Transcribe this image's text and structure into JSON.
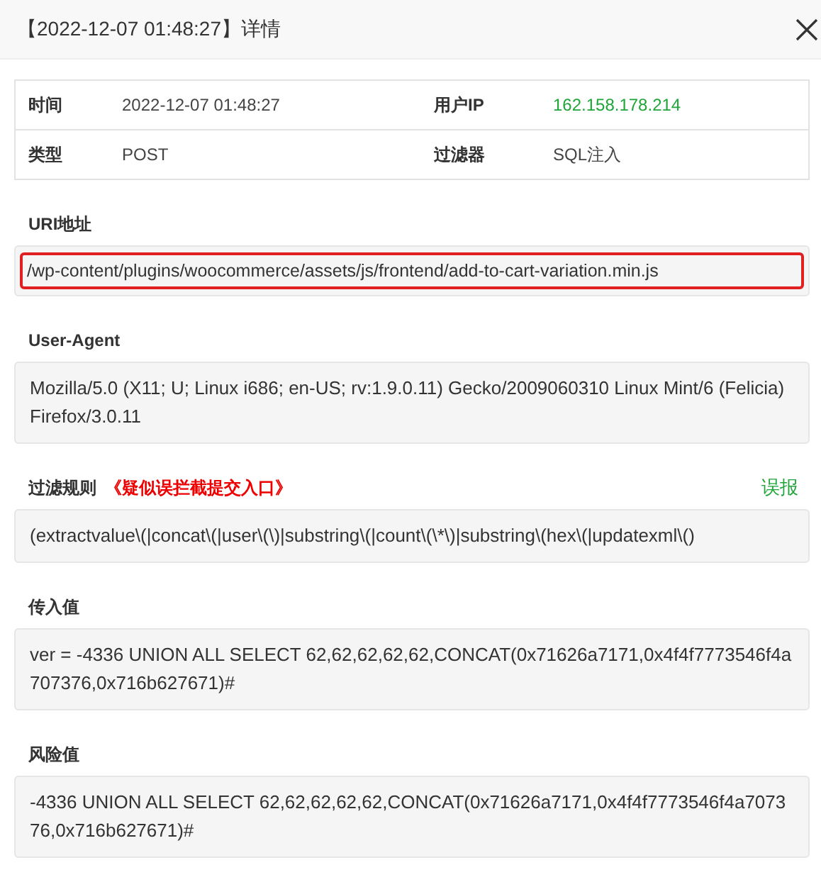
{
  "dialog": {
    "title": "【2022-12-07 01:48:27】详情"
  },
  "info_rows": [
    {
      "cells": [
        {
          "label": "时间",
          "value": "2022-12-07 01:48:27",
          "kind": "plain"
        },
        {
          "label": "用户IP",
          "value": "162.158.178.214",
          "kind": "ip"
        }
      ]
    },
    {
      "cells": [
        {
          "label": "类型",
          "value": "POST",
          "kind": "plain"
        },
        {
          "label": "过滤器",
          "value": "SQL注入",
          "kind": "plain"
        }
      ]
    }
  ],
  "sections": [
    {
      "label": "URI地址",
      "value": "/wp-content/plugins/woocommerce/assets/js/frontend/add-to-cart-variation.min.js",
      "highlighted": true
    },
    {
      "label": "User-Agent",
      "value": "Mozilla/5.0 (X11; U; Linux i686; en-US; rv:1.9.0.11) Gecko/2009060310 Linux Mint/6 (Felicia) Firefox/3.0.11",
      "highlighted": false
    },
    {
      "label": "过滤规则",
      "note": "《疑似误拦截提交入口》",
      "action": "误报",
      "value": "(extractvalue\\(|concat\\(|user\\(\\)|substring\\(|count\\(\\*\\)|substring\\(hex\\(|updatexml\\()",
      "highlighted": false
    },
    {
      "label": "传入值",
      "value": "ver = -4336 UNION ALL SELECT 62,62,62,62,62,CONCAT(0x71626a7171,0x4f4f7773546f4a707376,0x716b627671)#",
      "highlighted": false
    },
    {
      "label": "风险值",
      "value": "-4336 UNION ALL SELECT 62,62,62,62,62,CONCAT(0x71626a7171,0x4f4f7773546f4a707376,0x716b627671)#",
      "highlighted": false
    }
  ]
}
